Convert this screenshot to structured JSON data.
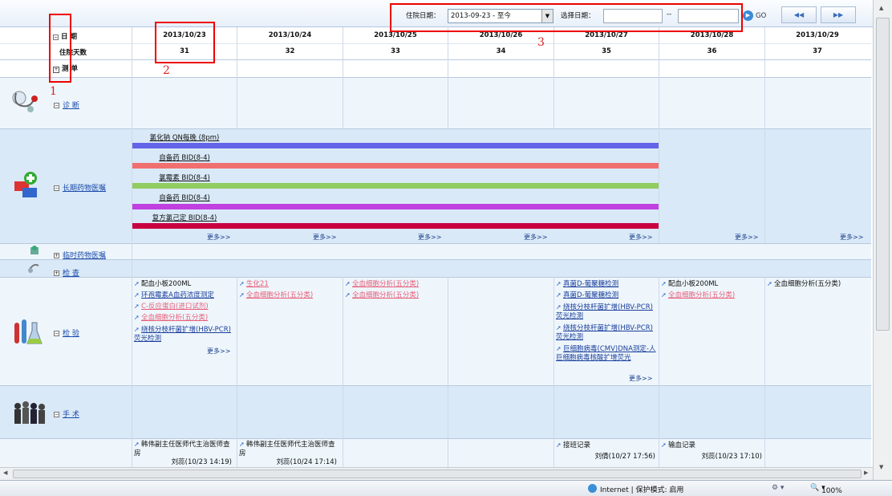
{
  "toolbar": {
    "admit_label": "住院日期：",
    "admit_value": "2013-09-23 - 至今",
    "select_label": "选择日期：",
    "range_sep": "--",
    "go_label": "GO",
    "prev_icon": "◀◀",
    "next_icon": "▶▶"
  },
  "header": {
    "date_label": "日  期",
    "days_label": "住院天数",
    "measure_label": "测 单",
    "dates": [
      "2013/10/23",
      "2013/10/24",
      "2013/10/25",
      "2013/10/26",
      "2013/10/27",
      "2013/10/28",
      "2013/10/29"
    ],
    "days": [
      "31",
      "32",
      "33",
      "34",
      "35",
      "36",
      "37"
    ]
  },
  "sections": {
    "diagnosis": "诊  断",
    "long_term": "长期药物医嘱",
    "temporary": "临时药物医嘱",
    "exam": "检  查",
    "test": "检  验",
    "surgery": "手  术"
  },
  "drugs": [
    "氯化钠 QN每晚 (8pm)",
    "自备药 BID(8-4)",
    "氯霉素 BID(8-4)",
    "自备药 BID(8-4)",
    "复方氯己定 BID(8-4)"
  ],
  "drug_colors": [
    "#6464e8",
    "#f07070",
    "#90cc60",
    "#c040e0",
    "#c80040"
  ],
  "more_label": "更多>>",
  "tests": {
    "col1": [
      "配血小板200ML",
      "环孢霉素A血药浓度测定",
      "C-反应蛋白(进口试剂)",
      "全血细胞分析(五分类)",
      "绕核分枝杆菌扩增(HBV-PCR)荧光检测"
    ],
    "col2": [
      "生化21",
      "全血细胞分析(五分类)"
    ],
    "col3": [
      "全血细胞分析(五分类)",
      "全血细胞分析(五分类)"
    ],
    "col5": [
      "真菌D-葡聚糖检测",
      "真菌D-葡聚糖检测",
      "绕核分枝杆菌扩增(HBV-PCR)荧光检测",
      "绕核分枝杆菌扩增(HBV-PCR)荧光检测",
      "巨细胞病毒(CMV)DNA测定-人巨细胞病毒核酸扩增荧光"
    ],
    "col6": [
      "配血小板200ML",
      "全血细胞分析(五分类)"
    ],
    "col7": [
      "全血细胞分析(五分类)"
    ]
  },
  "records": {
    "r1": "韩伟副主任医师代主治医师查房",
    "r1_sig": "刘蕊(10/23 14:19)",
    "r2": "韩伟副主任医师代主治医师查房",
    "r2_sig": "刘蕊(10/24 17:14)",
    "r5": "接班记录",
    "r5_sig": "刘倩(10/27 17:56)",
    "r6": "输血记录",
    "r6_sig": "刘蕊(10/23 17:10)"
  },
  "annotations": [
    "1",
    "2",
    "3"
  ],
  "status": {
    "zone": "Internet | 保护模式: 启用",
    "zoom": "100%"
  }
}
